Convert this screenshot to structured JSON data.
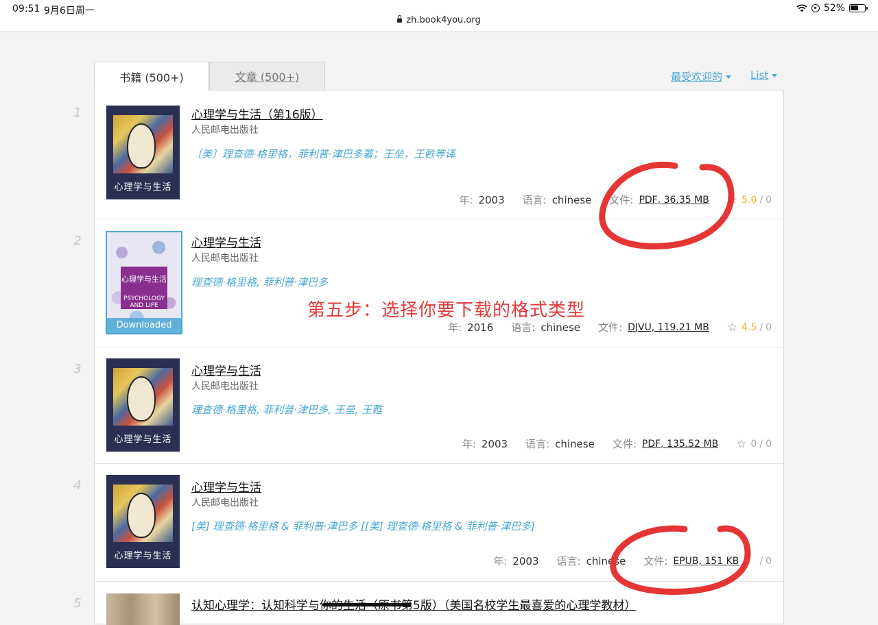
{
  "status_bar": {
    "time": "09:51",
    "date": "9月6日周一",
    "url": "zh.book4you.org",
    "battery": "52%"
  },
  "tabs": [
    {
      "label": "书籍 (500+)",
      "active": true
    },
    {
      "label": "文章 (500+)",
      "active": false
    }
  ],
  "sort": {
    "popular_label": "最受欢迎的",
    "view_label": "List"
  },
  "labels": {
    "year": "年:",
    "language": "语言:",
    "file": "文件:",
    "rating_sep": "/"
  },
  "annotation": "第五步：选择你要下载的格式类型",
  "books": [
    {
      "index": "1",
      "title": "心理学与生活（第16版）",
      "publisher": "人民邮电出版社",
      "authors": "〔美〕理查德·格里格，菲利普·津巴多著；王垒，王甦等译",
      "year": "2003",
      "language": "chinese",
      "file": "PDF, 36.35 MB",
      "rating": "5.0",
      "rating_count": "0",
      "cover_title": "心理学与生活"
    },
    {
      "index": "2",
      "title": "心理学与生活",
      "publisher": "人民邮电出版社",
      "authors": "理查德·格里格, 菲利普·津巴多",
      "year": "2016",
      "language": "chinese",
      "file": "DJVU, 119.21 MB",
      "rating": "4.5",
      "rating_count": "0",
      "cover_title": "心理学与生活",
      "cover_subtitle": "PSYCHOLOGY AND LIFE",
      "downloaded_label": "Downloaded"
    },
    {
      "index": "3",
      "title": "心理学与生活",
      "publisher": "人民邮电出版社",
      "authors": "理查德·格里格, 菲利普·津巴多, 王垒, 王甦",
      "year": "2003",
      "language": "chinese",
      "file": "PDF, 135.52 MB",
      "rating": "0",
      "rating_count": "0",
      "cover_title": "心理学与生活"
    },
    {
      "index": "4",
      "title": "心理学与生活",
      "publisher": "人民邮电出版社",
      "authors": "[美] 理查德·格里格 & 菲利普·津巴多 [[美] 理查德·格里格 & 菲利普·津巴多]",
      "year": "2003",
      "language": "chinese",
      "file": "EPUB, 151 KB",
      "rating_count": "0",
      "cover_title": "心理学与生活"
    },
    {
      "index": "5",
      "title": "认知心理学：认知科学与你的生活（原书第5版）（美国名校学生最喜爱的心理学教材）"
    }
  ],
  "colors": {
    "accent": "#49a7d4",
    "annotation": "#e13b3b",
    "star": "#e7b422"
  }
}
